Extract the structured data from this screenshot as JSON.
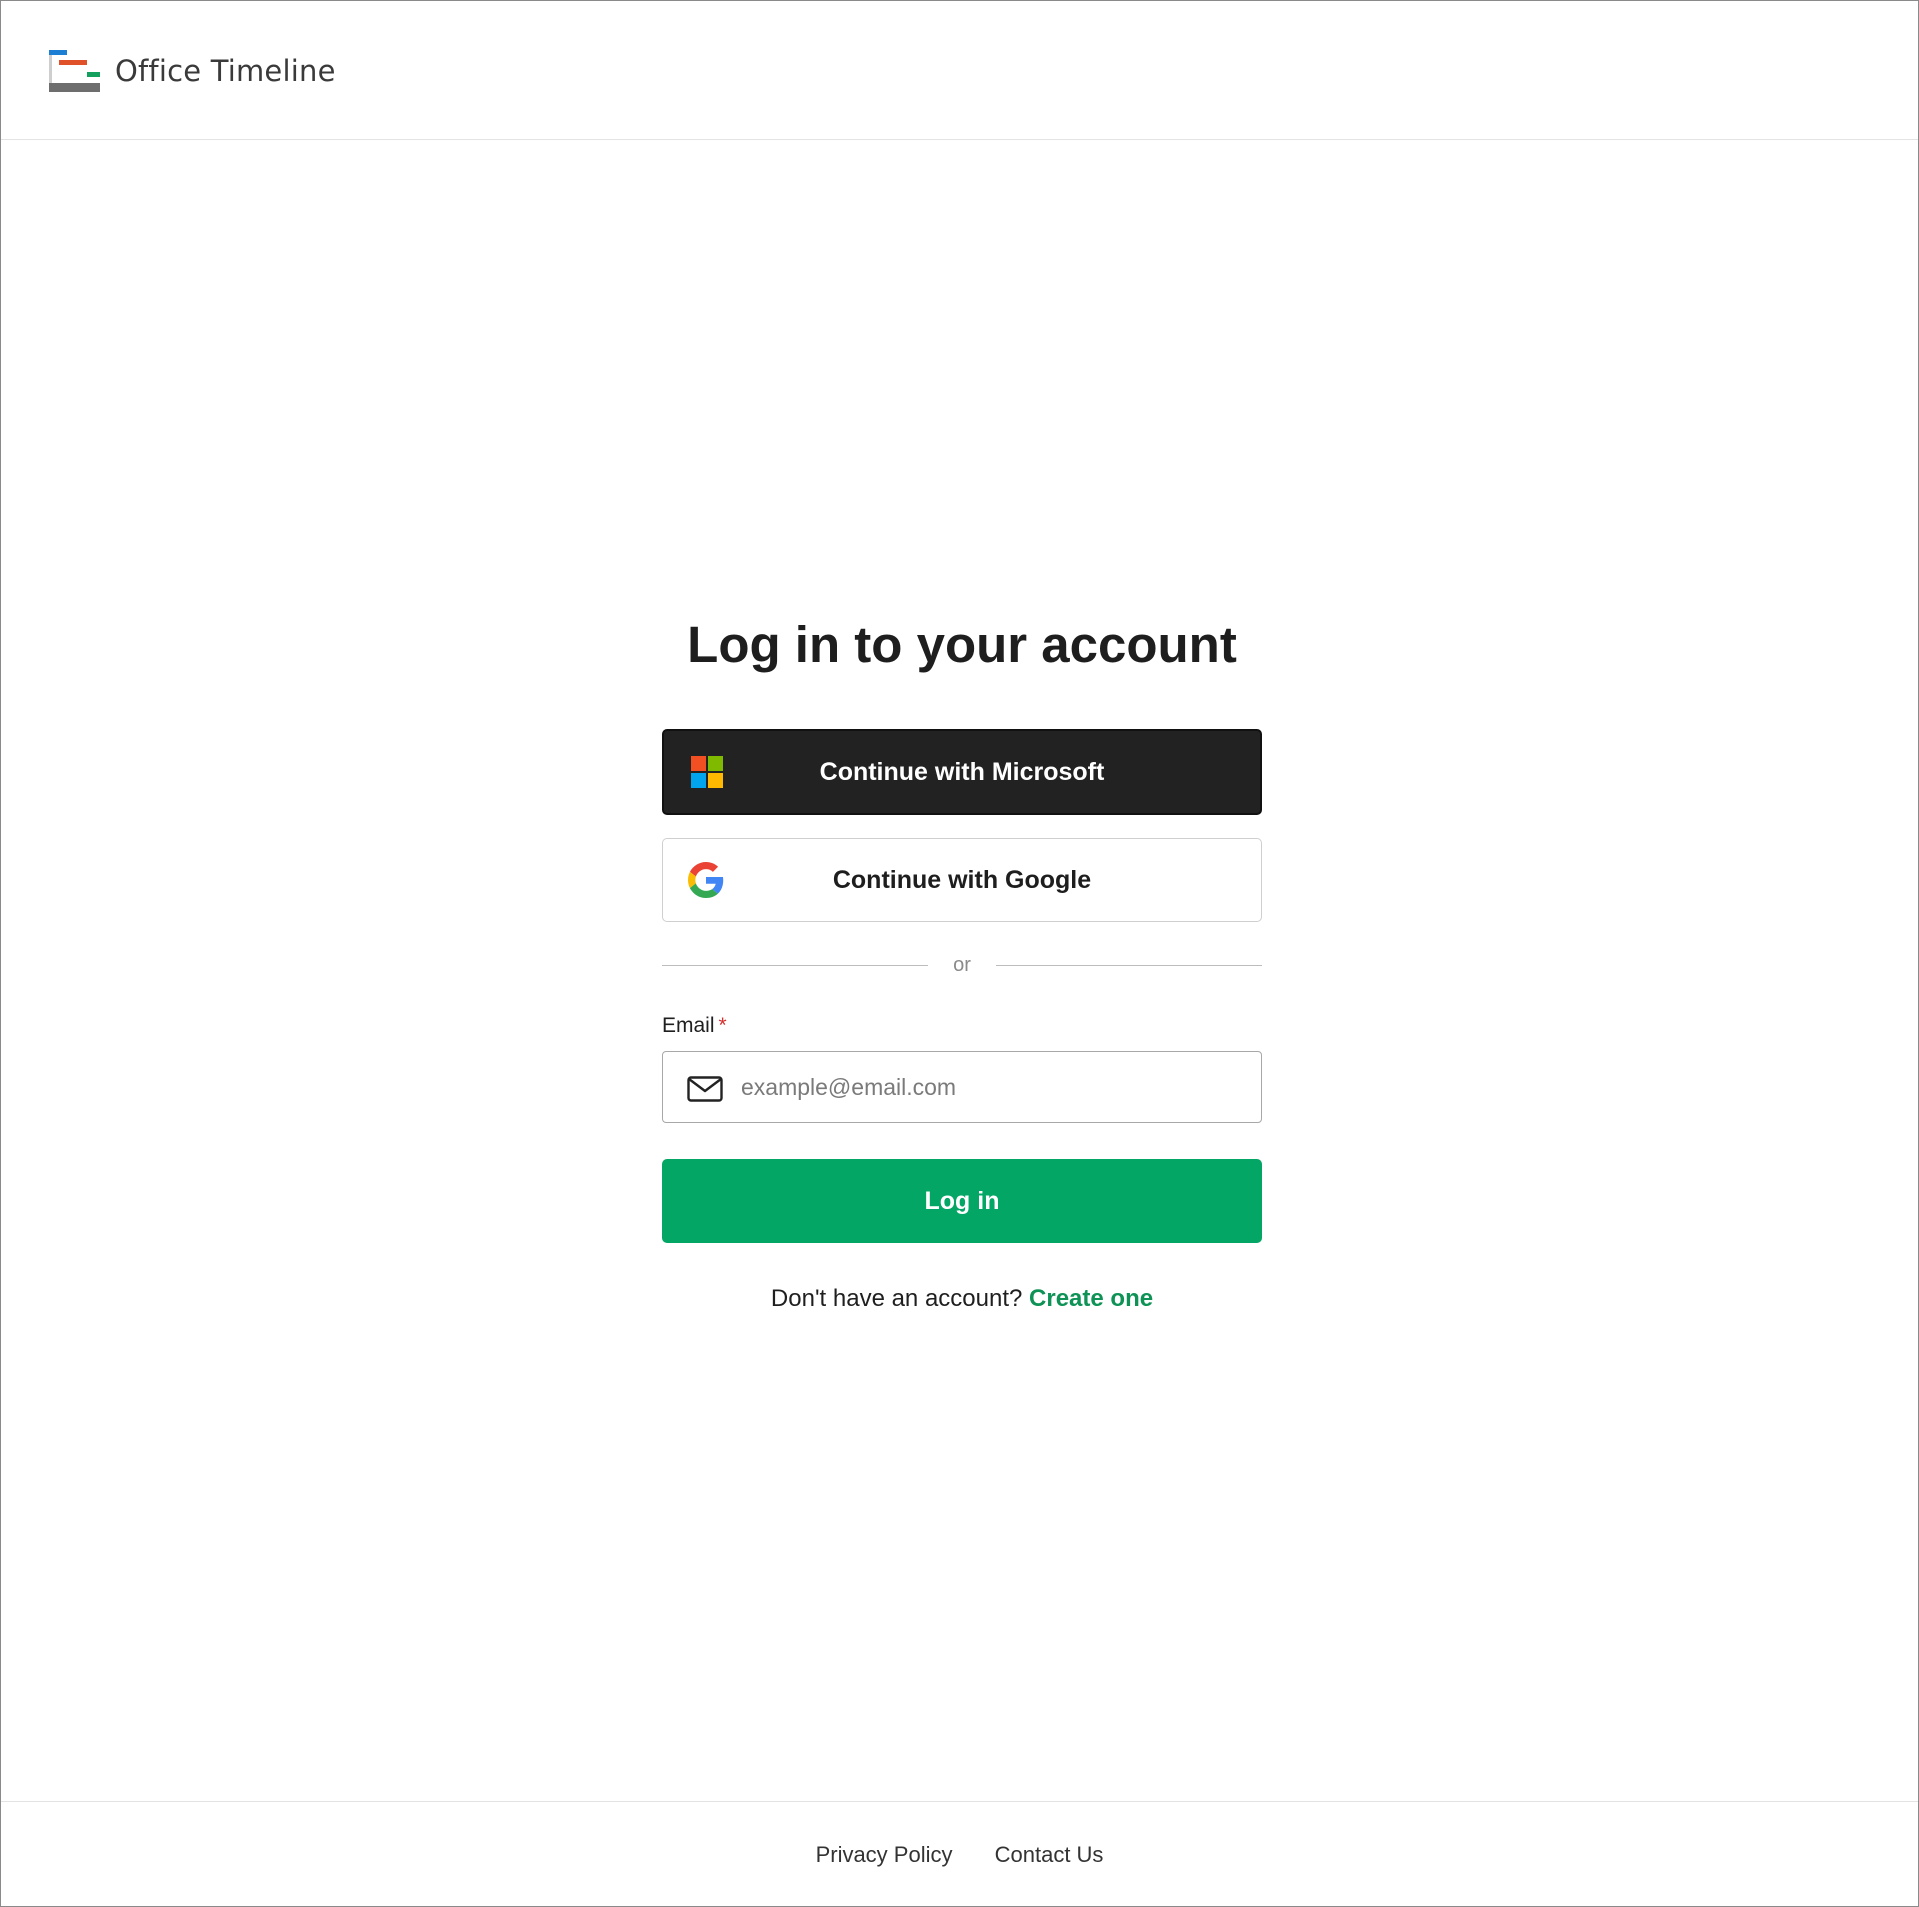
{
  "header": {
    "brand_name": "Office Timeline",
    "logo_colors": [
      "#1d7fd3",
      "#e0512a",
      "#13a05d",
      "#6e6e6e"
    ]
  },
  "main": {
    "title": "Log in to your account",
    "microsoft_button": {
      "label": "Continue with Microsoft",
      "icon": "microsoft-logo-icon"
    },
    "google_button": {
      "label": "Continue with Google",
      "icon": "google-logo-icon"
    },
    "divider_text": "or",
    "email_field": {
      "label": "Email",
      "required_marker": "*",
      "placeholder": "example@email.com",
      "value": "",
      "icon": "mail-icon"
    },
    "login_button": {
      "label": "Log in"
    },
    "signup_prompt": "Don't have an account?",
    "signup_link": "Create one"
  },
  "footer": {
    "privacy": "Privacy Policy",
    "contact": "Contact Us"
  },
  "colors": {
    "primary_green": "#03a664",
    "link_green": "#0e9255",
    "dark_button": "#222222",
    "required_red": "#d32f2f"
  }
}
